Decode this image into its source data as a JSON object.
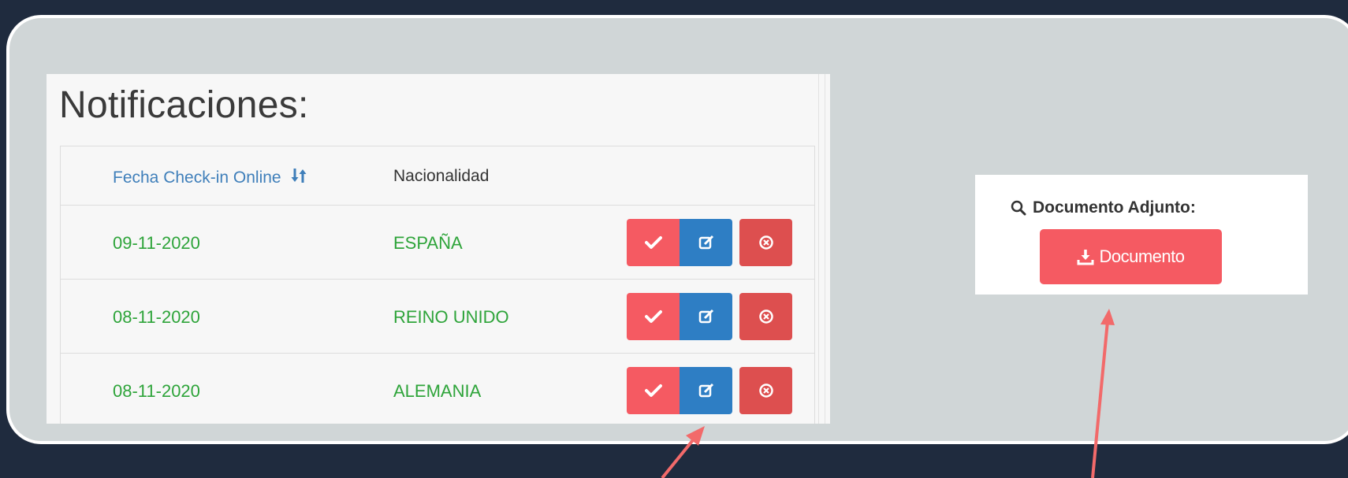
{
  "notifications": {
    "title": "Notificaciones:",
    "columns": {
      "date": "Fecha Check-in Online",
      "nationality": "Nacionalidad"
    },
    "rows": [
      {
        "date": "09-11-2020",
        "nationality": "ESPAÑA"
      },
      {
        "date": "08-11-2020",
        "nationality": "REINO UNIDO"
      },
      {
        "date": "08-11-2020",
        "nationality": "ALEMANIA"
      }
    ],
    "row_actions": [
      "check-icon",
      "edit-icon",
      "cancel-icon"
    ]
  },
  "attachment": {
    "label": "Documento Adjunto:",
    "button_label": "Documento",
    "icons": [
      "search-icon",
      "download-icon"
    ]
  },
  "colors": {
    "page_bg": "#1f2b3e",
    "frame_bg": "#d0d6d7",
    "accent_red": "#f55a62",
    "accent_blue": "#2e7ec4",
    "danger_red": "#dd4f4f",
    "date_green": "#2ea43a",
    "link_blue": "#3f7fba",
    "annotation_arrow": "#f26a6a"
  }
}
